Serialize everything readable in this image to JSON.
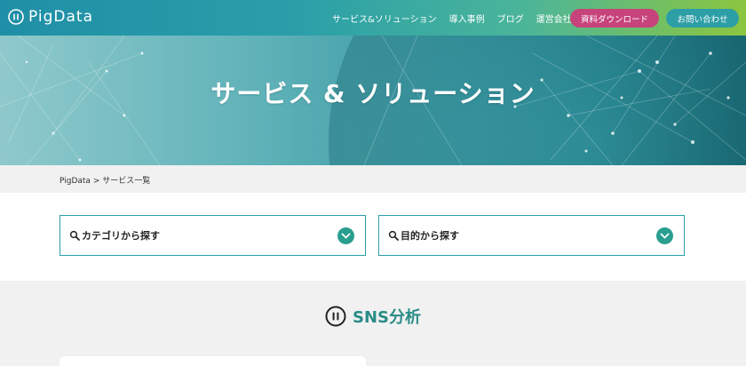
{
  "header": {
    "logo_text": "PigData",
    "nav": [
      "サービス&ソリューション",
      "導入事例",
      "ブログ",
      "運営会社"
    ],
    "download_label": "資料ダウンロード",
    "contact_label": "お問い合わせ"
  },
  "hero": {
    "title": "サービス & ソリューション"
  },
  "breadcrumb": {
    "home": "PigData",
    "separator": ">",
    "current": "サービス一覧"
  },
  "filters": {
    "category_label": "カテゴリから探す",
    "purpose_label": "目的から探す"
  },
  "section": {
    "title": "SNS分析"
  },
  "colors": {
    "accent": "#2a9ea6",
    "pink": "#c7437b",
    "section_title": "#2a8c86",
    "chevron": "#2a9e8f"
  }
}
